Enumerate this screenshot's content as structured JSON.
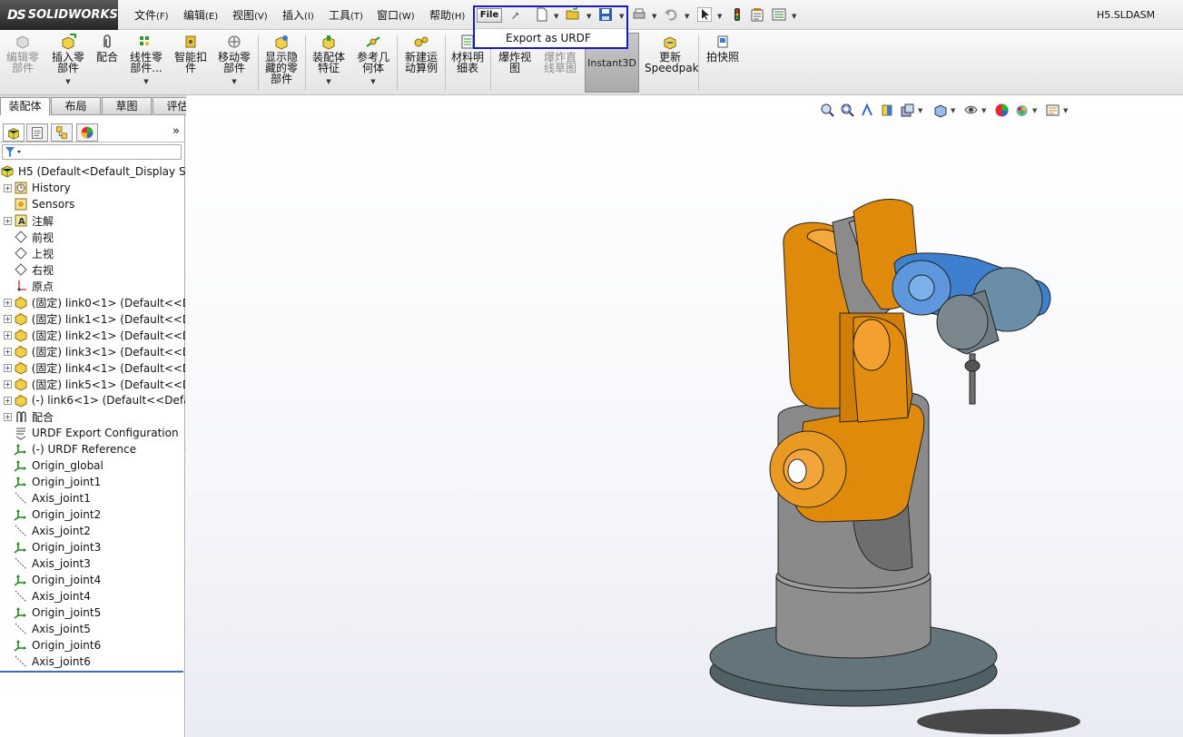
{
  "app": {
    "logo_prefix": "DS",
    "logo_text": "SOLIDWORKS",
    "document_title": "H5.SLDASM"
  },
  "menu": {
    "items": [
      {
        "label": "文件",
        "acc": "(F)"
      },
      {
        "label": "编辑",
        "acc": "(E)"
      },
      {
        "label": "视图",
        "acc": "(V)"
      },
      {
        "label": "插入",
        "acc": "(I)"
      },
      {
        "label": "工具",
        "acc": "(T)"
      },
      {
        "label": "窗口",
        "acc": "(W)"
      },
      {
        "label": "帮助",
        "acc": "(H)"
      }
    ],
    "file_button": "File",
    "export_menu_item": "Export as URDF"
  },
  "commands": {
    "edit_component": [
      "编辑零",
      "部件"
    ],
    "insert_component": [
      "插入零",
      "部件"
    ],
    "mate": "配合",
    "linear_pattern": [
      "线性零",
      "部件..."
    ],
    "smart_fasteners": [
      "智能扣",
      "件"
    ],
    "move_component": [
      "移动零",
      "部件"
    ],
    "show_hidden": [
      "显示隐",
      "藏的零",
      "部件"
    ],
    "assembly_features": [
      "装配体",
      "特征"
    ],
    "reference_geometry": [
      "参考几",
      "何体"
    ],
    "new_motion_study": [
      "新建运",
      "动算例"
    ],
    "bom": [
      "材料明",
      "细表"
    ],
    "exploded_view": [
      "爆炸视",
      "图"
    ],
    "explode_line_sketch": [
      "爆炸直",
      "线草图"
    ],
    "instant3d": "Instant3D",
    "update_speedpak": [
      "更新",
      "Speedpak"
    ],
    "snapshot": "拍快照"
  },
  "tabs": [
    "装配体",
    "布局",
    "草图",
    "评估"
  ],
  "tree": {
    "root": "H5  (Default<Default_Display St",
    "nodes": [
      {
        "label": "History",
        "icon": "history-icon",
        "exp": true
      },
      {
        "label": "Sensors",
        "icon": "sensors-icon",
        "exp": false
      },
      {
        "label": "注解",
        "icon": "annotations-icon",
        "exp": true
      },
      {
        "label": "前视",
        "icon": "plane-icon",
        "exp": false
      },
      {
        "label": "上视",
        "icon": "plane-icon",
        "exp": false
      },
      {
        "label": "右视",
        "icon": "plane-icon",
        "exp": false
      },
      {
        "label": "原点",
        "icon": "origin-icon",
        "exp": false
      },
      {
        "label": "(固定) link0<1> (Default<<D",
        "icon": "part-icon",
        "exp": true
      },
      {
        "label": "(固定) link1<1> (Default<<D",
        "icon": "part-icon",
        "exp": true
      },
      {
        "label": "(固定) link2<1> (Default<<D",
        "icon": "part-icon",
        "exp": true
      },
      {
        "label": "(固定) link3<1> (Default<<D",
        "icon": "part-icon",
        "exp": true
      },
      {
        "label": "(固定) link4<1> (Default<<D",
        "icon": "part-icon",
        "exp": true
      },
      {
        "label": "(固定) link5<1> (Default<<D",
        "icon": "part-icon",
        "exp": true
      },
      {
        "label": "(-) link6<1> (Default<<Defa",
        "icon": "part-icon",
        "exp": true
      },
      {
        "label": "配合",
        "icon": "mates-icon",
        "exp": true
      },
      {
        "label": "URDF Export Configuration",
        "icon": "urdf-config-icon",
        "exp": false
      },
      {
        "label": "(-) URDF Reference",
        "icon": "coordinate-system-icon",
        "exp": false
      },
      {
        "label": "Origin_global",
        "icon": "coordinate-system-icon",
        "exp": false
      },
      {
        "label": "Origin_joint1",
        "icon": "coordinate-system-icon",
        "exp": false
      },
      {
        "label": "Axis_joint1",
        "icon": "axis-icon",
        "exp": false
      },
      {
        "label": "Origin_joint2",
        "icon": "coordinate-system-icon",
        "exp": false
      },
      {
        "label": "Axis_joint2",
        "icon": "axis-icon",
        "exp": false
      },
      {
        "label": "Origin_joint3",
        "icon": "coordinate-system-icon",
        "exp": false
      },
      {
        "label": "Axis_joint3",
        "icon": "axis-icon",
        "exp": false
      },
      {
        "label": "Origin_joint4",
        "icon": "coordinate-system-icon",
        "exp": false
      },
      {
        "label": "Axis_joint4",
        "icon": "axis-icon",
        "exp": false
      },
      {
        "label": "Origin_joint5",
        "icon": "coordinate-system-icon",
        "exp": false
      },
      {
        "label": "Axis_joint5",
        "icon": "axis-icon",
        "exp": false
      },
      {
        "label": "Origin_joint6",
        "icon": "coordinate-system-icon",
        "exp": false
      },
      {
        "label": "Axis_joint6",
        "icon": "axis-icon",
        "exp": false
      }
    ]
  },
  "colors": {
    "highlight_box": "#1a1ab8",
    "robot_orange": "#e08a0c",
    "robot_gray": "#8e8e8e",
    "robot_blue": "#3f7fcf",
    "base_teal": "#63757a"
  }
}
